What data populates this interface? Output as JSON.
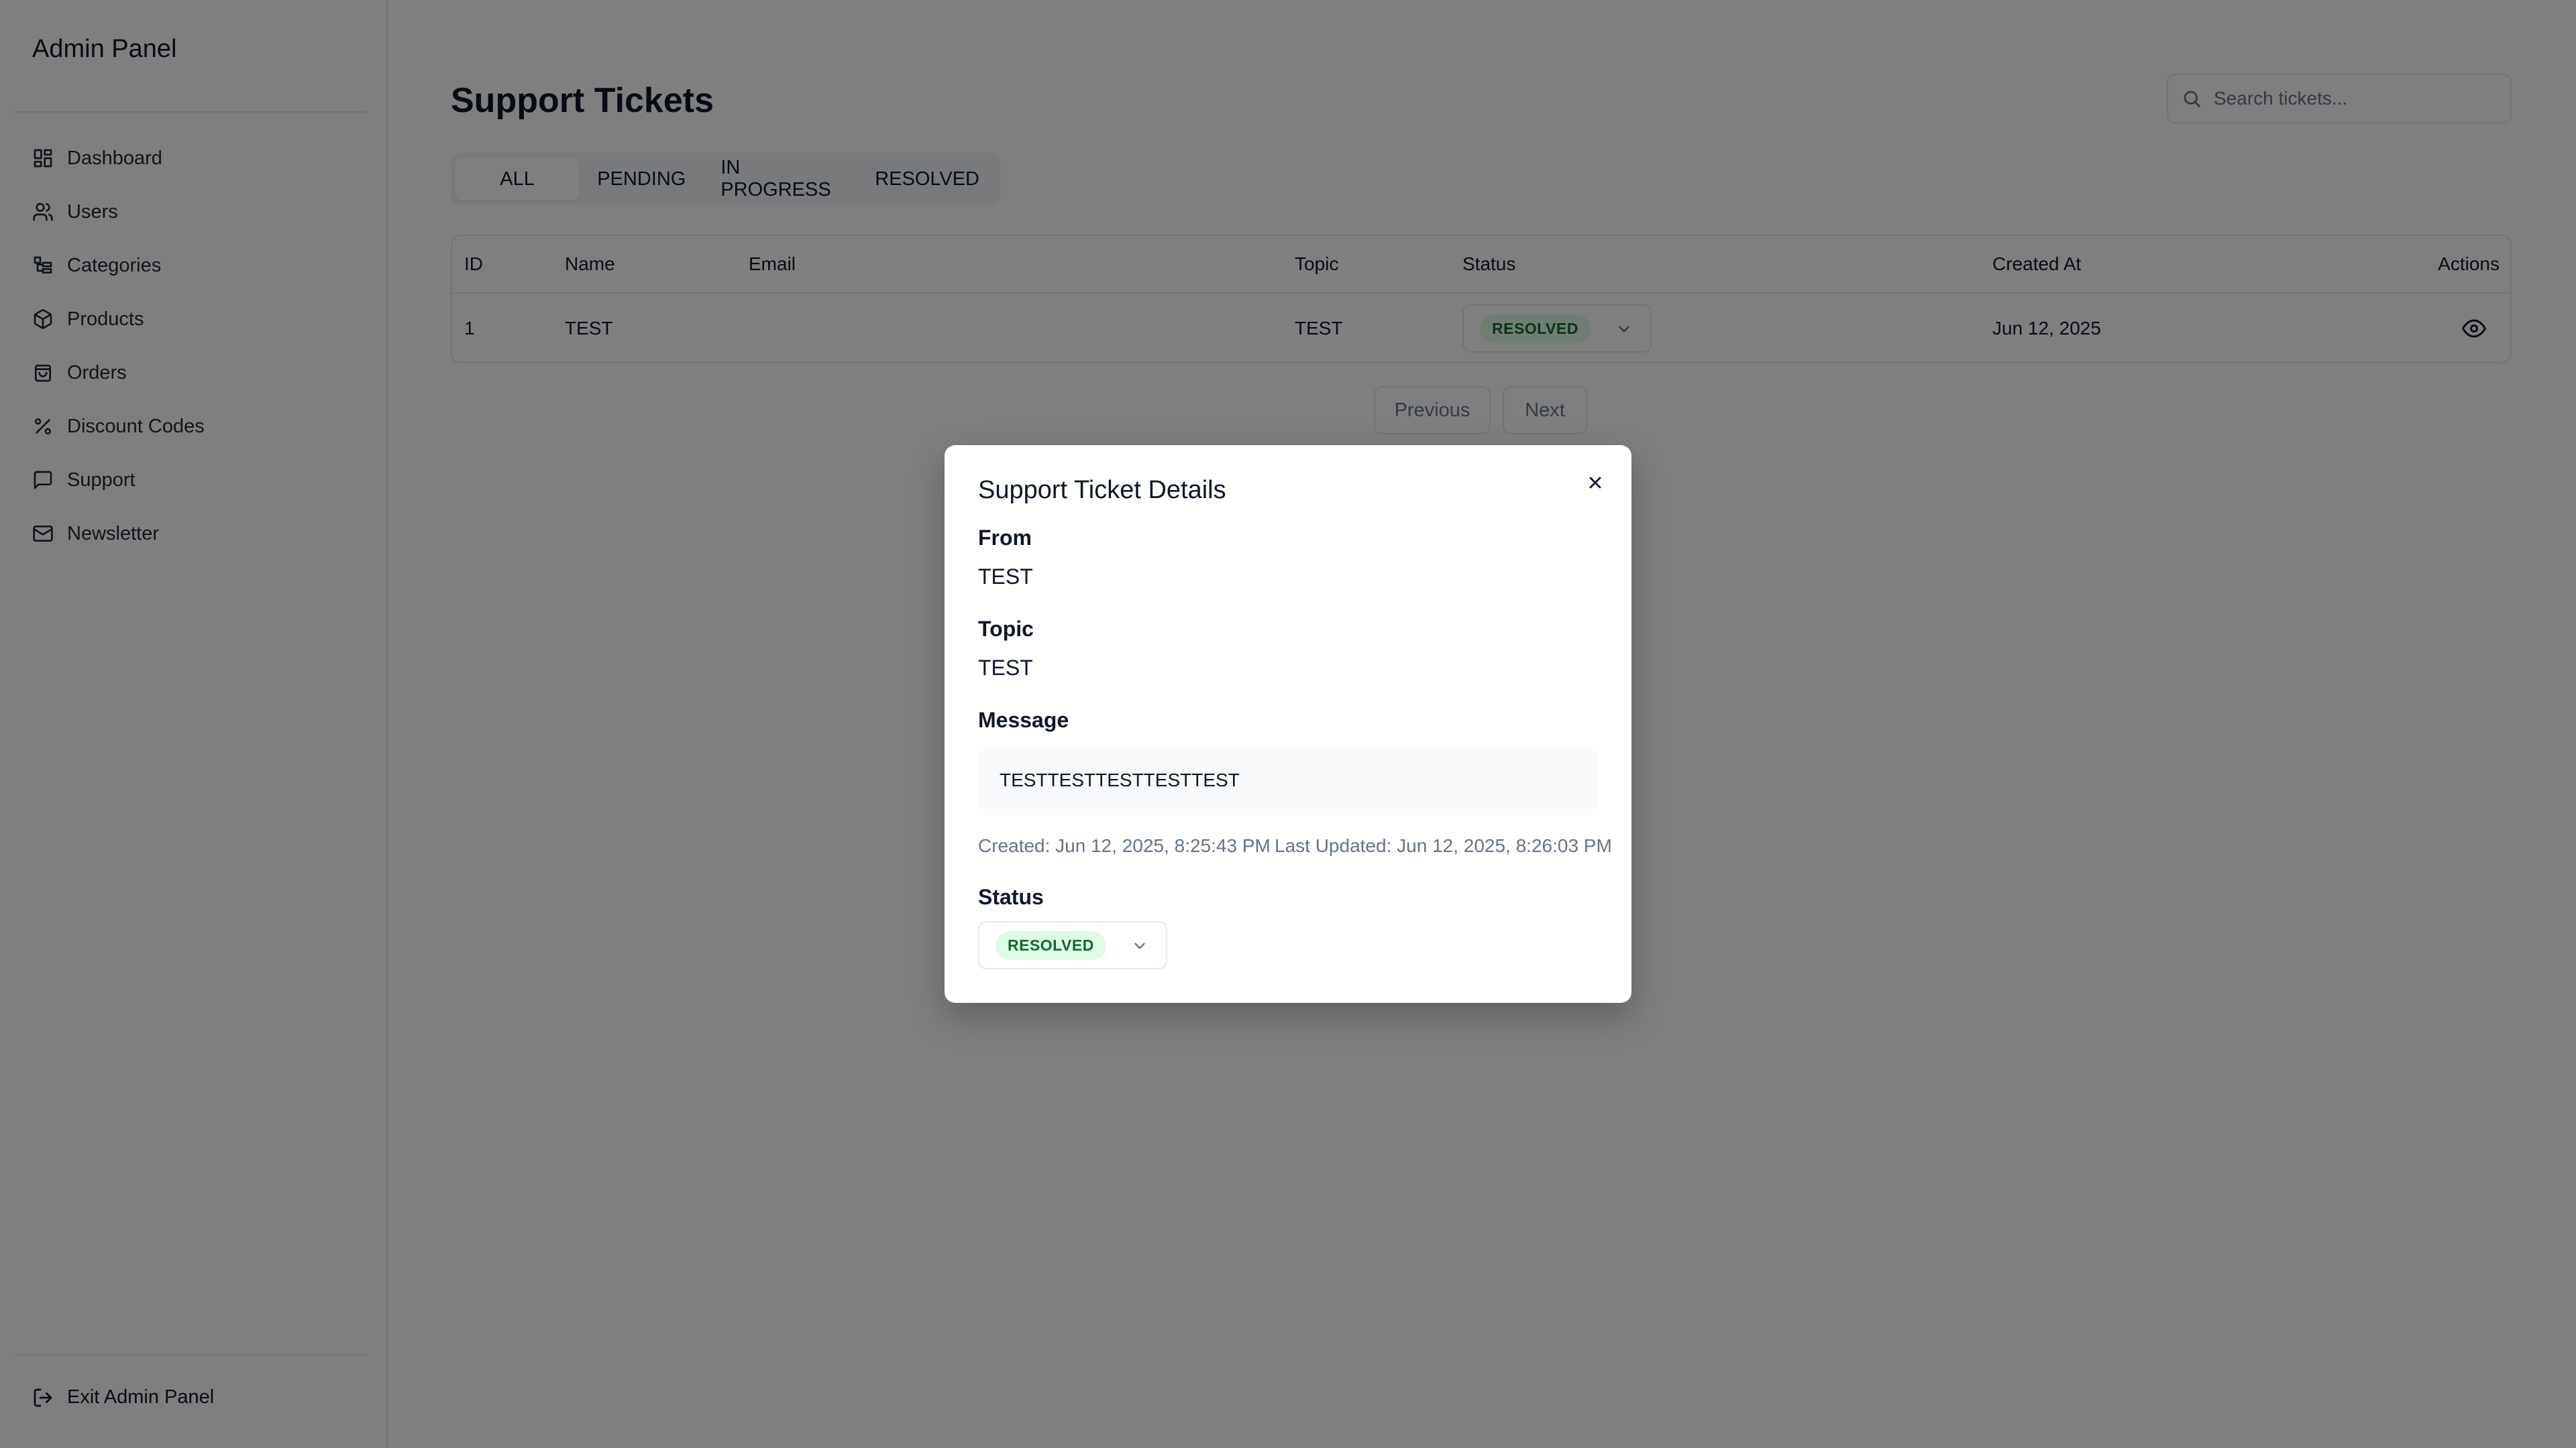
{
  "sidebar": {
    "brand": "Admin Panel",
    "items": [
      {
        "label": "Dashboard",
        "icon": "dashboard-icon"
      },
      {
        "label": "Users",
        "icon": "users-icon"
      },
      {
        "label": "Categories",
        "icon": "categories-icon"
      },
      {
        "label": "Products",
        "icon": "package-icon"
      },
      {
        "label": "Orders",
        "icon": "shopping-bag-icon"
      },
      {
        "label": "Discount Codes",
        "icon": "percent-icon"
      },
      {
        "label": "Support",
        "icon": "message-square-icon"
      },
      {
        "label": "Newsletter",
        "icon": "mail-icon"
      }
    ],
    "exit_label": "Exit Admin Panel"
  },
  "main": {
    "title": "Support Tickets",
    "search_placeholder": "Search tickets...",
    "tabs": [
      {
        "label": "ALL",
        "active": true
      },
      {
        "label": "PENDING",
        "active": false
      },
      {
        "label": "IN PROGRESS",
        "active": false
      },
      {
        "label": "RESOLVED",
        "active": false
      }
    ],
    "table": {
      "headers": [
        "ID",
        "Name",
        "Email",
        "Topic",
        "Status",
        "Created At",
        "Actions"
      ],
      "rows": [
        {
          "id": "1",
          "name": "TEST",
          "email": "",
          "topic": "TEST",
          "status": "RESOLVED",
          "created_at": "Jun 12, 2025"
        }
      ]
    },
    "pagination": {
      "previous": "Previous",
      "next": "Next"
    }
  },
  "modal": {
    "title": "Support Ticket Details",
    "from_label": "From",
    "from_value": "TEST",
    "topic_label": "Topic",
    "topic_value": "TEST",
    "message_label": "Message",
    "message_value": "TESTTESTTESTTESTTEST",
    "created": "Created: Jun 12, 2025, 8:25:43 PM",
    "last_updated": "Last Updated: Jun 12, 2025, 8:26:03 PM",
    "status_label": "Status",
    "status_value": "RESOLVED"
  },
  "colors": {
    "badge_bg": "#dcfce7",
    "badge_text": "#166534",
    "overlay": "rgba(0,0,0,0.5)"
  }
}
